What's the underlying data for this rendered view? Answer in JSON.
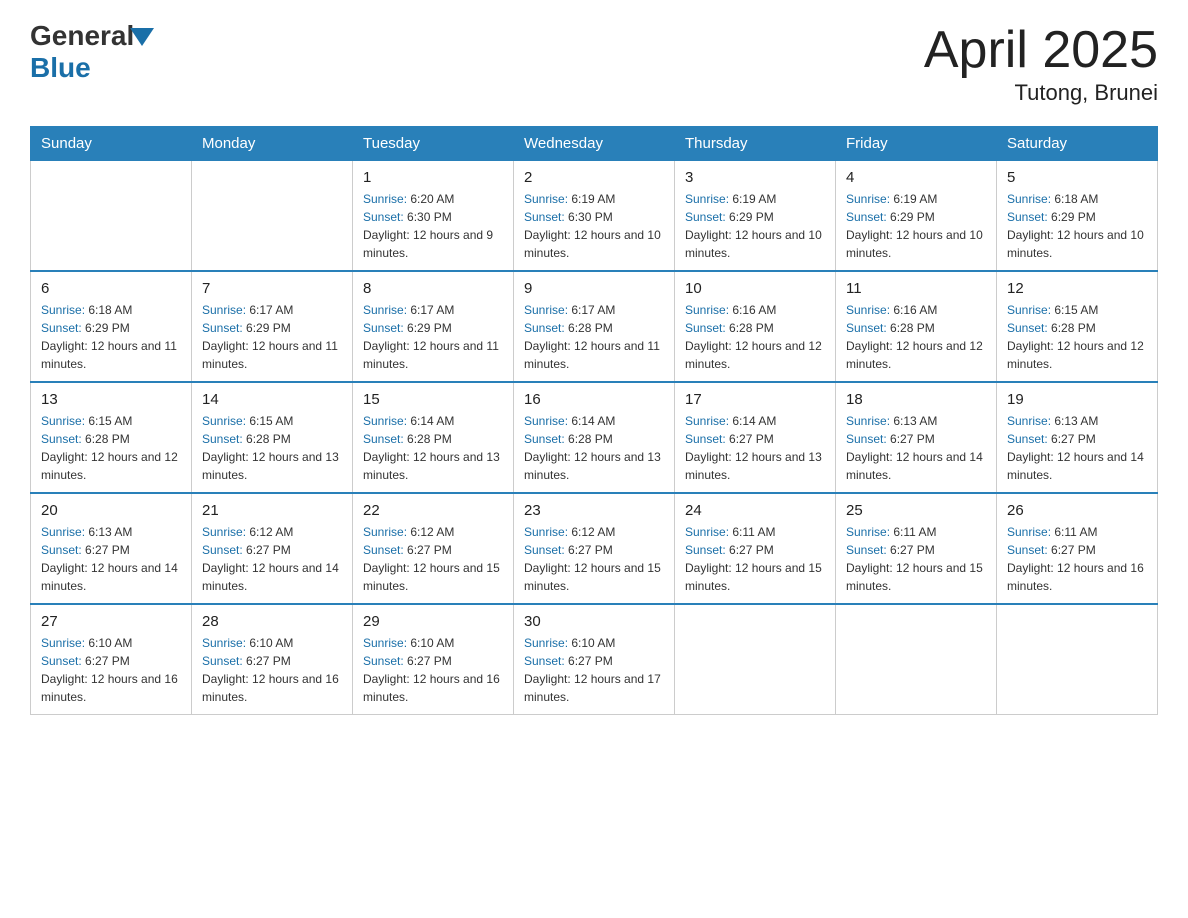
{
  "logo": {
    "general": "General",
    "blue": "Blue"
  },
  "title": "April 2025",
  "subtitle": "Tutong, Brunei",
  "weekdays": [
    "Sunday",
    "Monday",
    "Tuesday",
    "Wednesday",
    "Thursday",
    "Friday",
    "Saturday"
  ],
  "weeks": [
    [
      {
        "day": "",
        "sunrise": "",
        "sunset": "",
        "daylight": ""
      },
      {
        "day": "",
        "sunrise": "",
        "sunset": "",
        "daylight": ""
      },
      {
        "day": "1",
        "sunrise": "6:20 AM",
        "sunset": "6:30 PM",
        "daylight": "12 hours and 9 minutes."
      },
      {
        "day": "2",
        "sunrise": "6:19 AM",
        "sunset": "6:30 PM",
        "daylight": "12 hours and 10 minutes."
      },
      {
        "day": "3",
        "sunrise": "6:19 AM",
        "sunset": "6:29 PM",
        "daylight": "12 hours and 10 minutes."
      },
      {
        "day": "4",
        "sunrise": "6:19 AM",
        "sunset": "6:29 PM",
        "daylight": "12 hours and 10 minutes."
      },
      {
        "day": "5",
        "sunrise": "6:18 AM",
        "sunset": "6:29 PM",
        "daylight": "12 hours and 10 minutes."
      }
    ],
    [
      {
        "day": "6",
        "sunrise": "6:18 AM",
        "sunset": "6:29 PM",
        "daylight": "12 hours and 11 minutes."
      },
      {
        "day": "7",
        "sunrise": "6:17 AM",
        "sunset": "6:29 PM",
        "daylight": "12 hours and 11 minutes."
      },
      {
        "day": "8",
        "sunrise": "6:17 AM",
        "sunset": "6:29 PM",
        "daylight": "12 hours and 11 minutes."
      },
      {
        "day": "9",
        "sunrise": "6:17 AM",
        "sunset": "6:28 PM",
        "daylight": "12 hours and 11 minutes."
      },
      {
        "day": "10",
        "sunrise": "6:16 AM",
        "sunset": "6:28 PM",
        "daylight": "12 hours and 12 minutes."
      },
      {
        "day": "11",
        "sunrise": "6:16 AM",
        "sunset": "6:28 PM",
        "daylight": "12 hours and 12 minutes."
      },
      {
        "day": "12",
        "sunrise": "6:15 AM",
        "sunset": "6:28 PM",
        "daylight": "12 hours and 12 minutes."
      }
    ],
    [
      {
        "day": "13",
        "sunrise": "6:15 AM",
        "sunset": "6:28 PM",
        "daylight": "12 hours and 12 minutes."
      },
      {
        "day": "14",
        "sunrise": "6:15 AM",
        "sunset": "6:28 PM",
        "daylight": "12 hours and 13 minutes."
      },
      {
        "day": "15",
        "sunrise": "6:14 AM",
        "sunset": "6:28 PM",
        "daylight": "12 hours and 13 minutes."
      },
      {
        "day": "16",
        "sunrise": "6:14 AM",
        "sunset": "6:28 PM",
        "daylight": "12 hours and 13 minutes."
      },
      {
        "day": "17",
        "sunrise": "6:14 AM",
        "sunset": "6:27 PM",
        "daylight": "12 hours and 13 minutes."
      },
      {
        "day": "18",
        "sunrise": "6:13 AM",
        "sunset": "6:27 PM",
        "daylight": "12 hours and 14 minutes."
      },
      {
        "day": "19",
        "sunrise": "6:13 AM",
        "sunset": "6:27 PM",
        "daylight": "12 hours and 14 minutes."
      }
    ],
    [
      {
        "day": "20",
        "sunrise": "6:13 AM",
        "sunset": "6:27 PM",
        "daylight": "12 hours and 14 minutes."
      },
      {
        "day": "21",
        "sunrise": "6:12 AM",
        "sunset": "6:27 PM",
        "daylight": "12 hours and 14 minutes."
      },
      {
        "day": "22",
        "sunrise": "6:12 AM",
        "sunset": "6:27 PM",
        "daylight": "12 hours and 15 minutes."
      },
      {
        "day": "23",
        "sunrise": "6:12 AM",
        "sunset": "6:27 PM",
        "daylight": "12 hours and 15 minutes."
      },
      {
        "day": "24",
        "sunrise": "6:11 AM",
        "sunset": "6:27 PM",
        "daylight": "12 hours and 15 minutes."
      },
      {
        "day": "25",
        "sunrise": "6:11 AM",
        "sunset": "6:27 PM",
        "daylight": "12 hours and 15 minutes."
      },
      {
        "day": "26",
        "sunrise": "6:11 AM",
        "sunset": "6:27 PM",
        "daylight": "12 hours and 16 minutes."
      }
    ],
    [
      {
        "day": "27",
        "sunrise": "6:10 AM",
        "sunset": "6:27 PM",
        "daylight": "12 hours and 16 minutes."
      },
      {
        "day": "28",
        "sunrise": "6:10 AM",
        "sunset": "6:27 PM",
        "daylight": "12 hours and 16 minutes."
      },
      {
        "day": "29",
        "sunrise": "6:10 AM",
        "sunset": "6:27 PM",
        "daylight": "12 hours and 16 minutes."
      },
      {
        "day": "30",
        "sunrise": "6:10 AM",
        "sunset": "6:27 PM",
        "daylight": "12 hours and 17 minutes."
      },
      {
        "day": "",
        "sunrise": "",
        "sunset": "",
        "daylight": ""
      },
      {
        "day": "",
        "sunrise": "",
        "sunset": "",
        "daylight": ""
      },
      {
        "day": "",
        "sunrise": "",
        "sunset": "",
        "daylight": ""
      }
    ]
  ],
  "labels": {
    "sunrise": "Sunrise: ",
    "sunset": "Sunset: ",
    "daylight": "Daylight: "
  }
}
